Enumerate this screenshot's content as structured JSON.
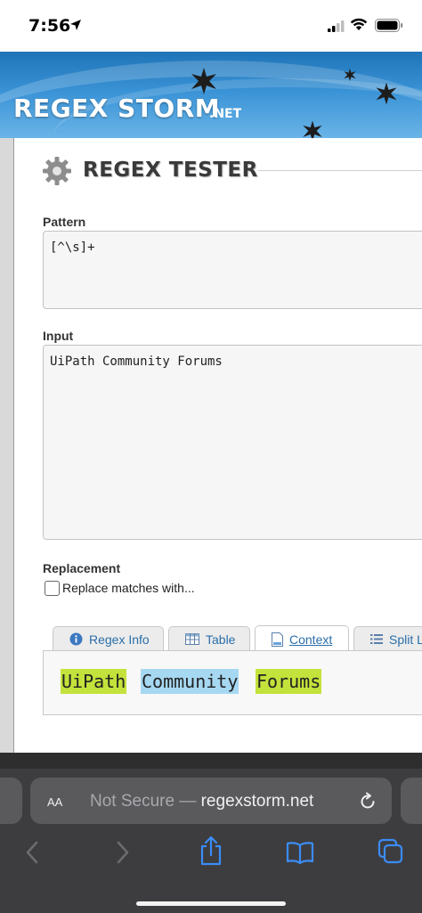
{
  "status_bar": {
    "time": "7:56"
  },
  "site": {
    "logo": "REGEX STORM",
    "logo_suffix": ".NET"
  },
  "tester": {
    "title": "REGEX TESTER",
    "pattern_label": "Pattern",
    "pattern_value": "[^\\s]+",
    "input_label": "Input",
    "input_value": "UiPath Community Forums",
    "replacement_label": "Replacement",
    "replace_checkbox_label": "Replace matches with...",
    "replace_checked": false
  },
  "tabs": [
    {
      "label": "Regex Info",
      "icon": "info-icon",
      "active": false
    },
    {
      "label": "Table",
      "icon": "table-icon",
      "active": false
    },
    {
      "label": "Context",
      "icon": "document-icon",
      "active": true
    },
    {
      "label": "Split L",
      "icon": "list-icon",
      "active": false
    }
  ],
  "context_matches": [
    {
      "text": "UiPath",
      "color": "#c3e23b"
    },
    {
      "text": "Community",
      "color": "#a6d8f2"
    },
    {
      "text": "Forums",
      "color": "#c3e23b"
    }
  ],
  "browser": {
    "aa_label": "AA",
    "not_secure": "Not Secure —",
    "domain": "regexstorm.net"
  },
  "colors": {
    "header_blue": "#2f86cc",
    "link_blue": "#2a6ea8",
    "browser_bg": "#3d3d3f"
  }
}
